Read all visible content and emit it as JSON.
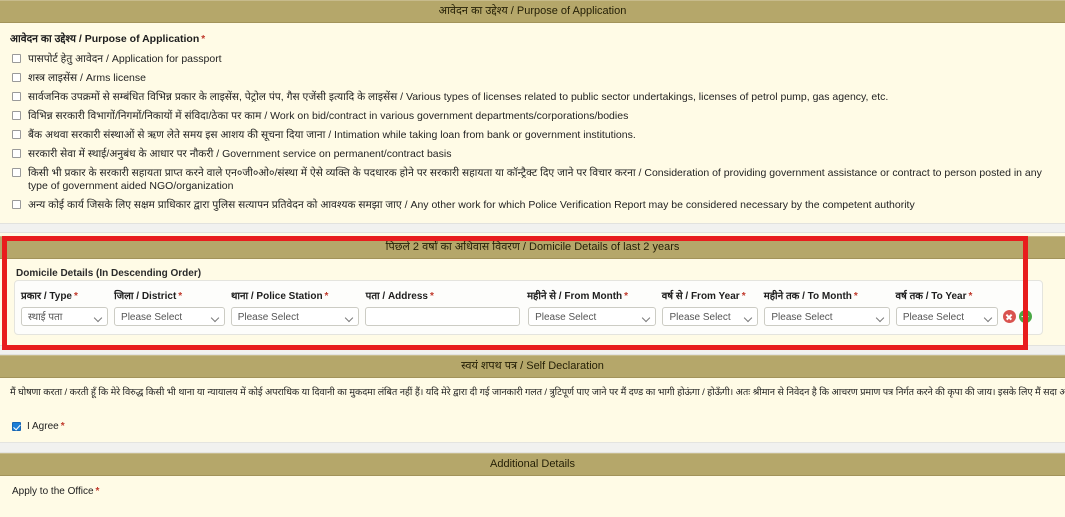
{
  "sections": {
    "purpose": {
      "bar_title": "आवेदन का उद्देश्य / Purpose of Application",
      "field_label": "आवेदन का उद्देश्य / Purpose of Application",
      "required_mark": "*",
      "options": [
        {
          "label": "पासपोर्ट हेतु आवेदन / Application for passport",
          "checked": false
        },
        {
          "label": "शस्त्र लाइसेंस / Arms license",
          "checked": false
        },
        {
          "label": "सार्वजनिक उपक्रमों से सम्बंधित विभिन्न प्रकार के लाइसेंस, पेट्रोल पंप, गैस एजेंसी इत्यादि के लाइसेंस / Various types of licenses related to public sector undertakings, licenses of petrol pump, gas agency, etc.",
          "checked": false
        },
        {
          "label": "विभिन्न सरकारी विभागों/निगमों/निकायों में संविदा/ठेका पर काम / Work on bid/contract in various government departments/corporations/bodies",
          "checked": false
        },
        {
          "label": "बैंक अथवा सरकारी संस्थाओं से ऋण लेते समय इस आशय की सूचना दिया जाना / Intimation while taking loan from bank or government institutions.",
          "checked": false
        },
        {
          "label": "सरकारी सेवा में स्थाई/अनुबंध के आधार पर नौकरी / Government service on permanent/contract basis",
          "checked": false
        },
        {
          "label": "किसी भी प्रकार के सरकारी सहायता प्राप्त करने वाले एन०जी०ओ०/संस्था में ऐसे व्यक्ति के पदधारक होने पर सरकारी सहायता या कॉन्ट्रैक्ट दिए जाने पर विचार करना / Consideration of providing government assistance or contract to person posted in any type of government aided NGO/organization",
          "checked": false
        },
        {
          "label": "अन्य कोई कार्य जिसके लिए सक्षम प्राधिकार द्वारा पुलिस सत्यापन प्रतिवेदन को आवश्यक समझा जाए / Any other work for which Police Verification Report may be considered necessary by the competent authority",
          "checked": false
        }
      ]
    },
    "domicile": {
      "bar_title": "पिछले 2 वर्षों का अधिवास विवरण / Domicile Details of last 2 years",
      "fieldset_title": "Domicile Details (In Descending Order)",
      "required_mark": "*",
      "columns": [
        {
          "label": "प्रकार / Type",
          "required": true
        },
        {
          "label": "जिला / District",
          "required": true
        },
        {
          "label": "थाना / Police Station",
          "required": true
        },
        {
          "label": "पता / Address",
          "required": true
        },
        {
          "label": "महीने से / From Month",
          "required": true
        },
        {
          "label": "वर्ष से / From Year",
          "required": true
        },
        {
          "label": "महीने तक / To Month",
          "required": true
        },
        {
          "label": "वर्ष तक / To Year",
          "required": true
        }
      ],
      "row": {
        "type_value": "स्थाई पता",
        "district_value": "Please Select",
        "police_station_value": "Please Select",
        "address_value": "",
        "address_placeholder": "",
        "from_month_value": "Please Select",
        "from_year_value": "Please Select",
        "to_month_value": "Please Select",
        "to_year_value": "Please Select"
      },
      "actions": {
        "delete_icon": "remove-circle-icon",
        "add_icon": "add-circle-icon"
      },
      "highlight_color": "#e81d1d"
    },
    "self_declaration": {
      "bar_title": "स्वयं शपथ पत्र / Self Declaration",
      "declaration_text": "मैं घोषणा करता / करती हूँ कि मेरे विरुद्ध किसी भी थाना या न्यायालय में कोई अपराधिक या दिवानी का मुकदमा लंबित नहीं हैं। यदि मेरे द्वारा दी गई जानकारी गलत / त्रुटिपूर्ण पाए जाने पर मैं दण्ड का भागी होऊंगा / होऊँगी। अतः श्रीमान से निवेदन है कि आचरण प्रमाण पत्र निर्गत करने की कृपा की जाय। इसके लिए मैं सदा आभारी रहूँगा / रहूँगी।",
      "agree_label": "I Agree",
      "agree_required": "*",
      "agree_checked": true
    },
    "additional": {
      "bar_title": "Additional Details",
      "apply_label": "Apply to the Office",
      "apply_required": "*"
    }
  },
  "theme": {
    "bar_bg": "#b5a76a",
    "page_bg": "#fffbe6",
    "accent_required": "#c0392b",
    "checkbox_checked": "#1c7ed6",
    "delete_btn": "#d9534f",
    "add_btn": "#49a845"
  }
}
